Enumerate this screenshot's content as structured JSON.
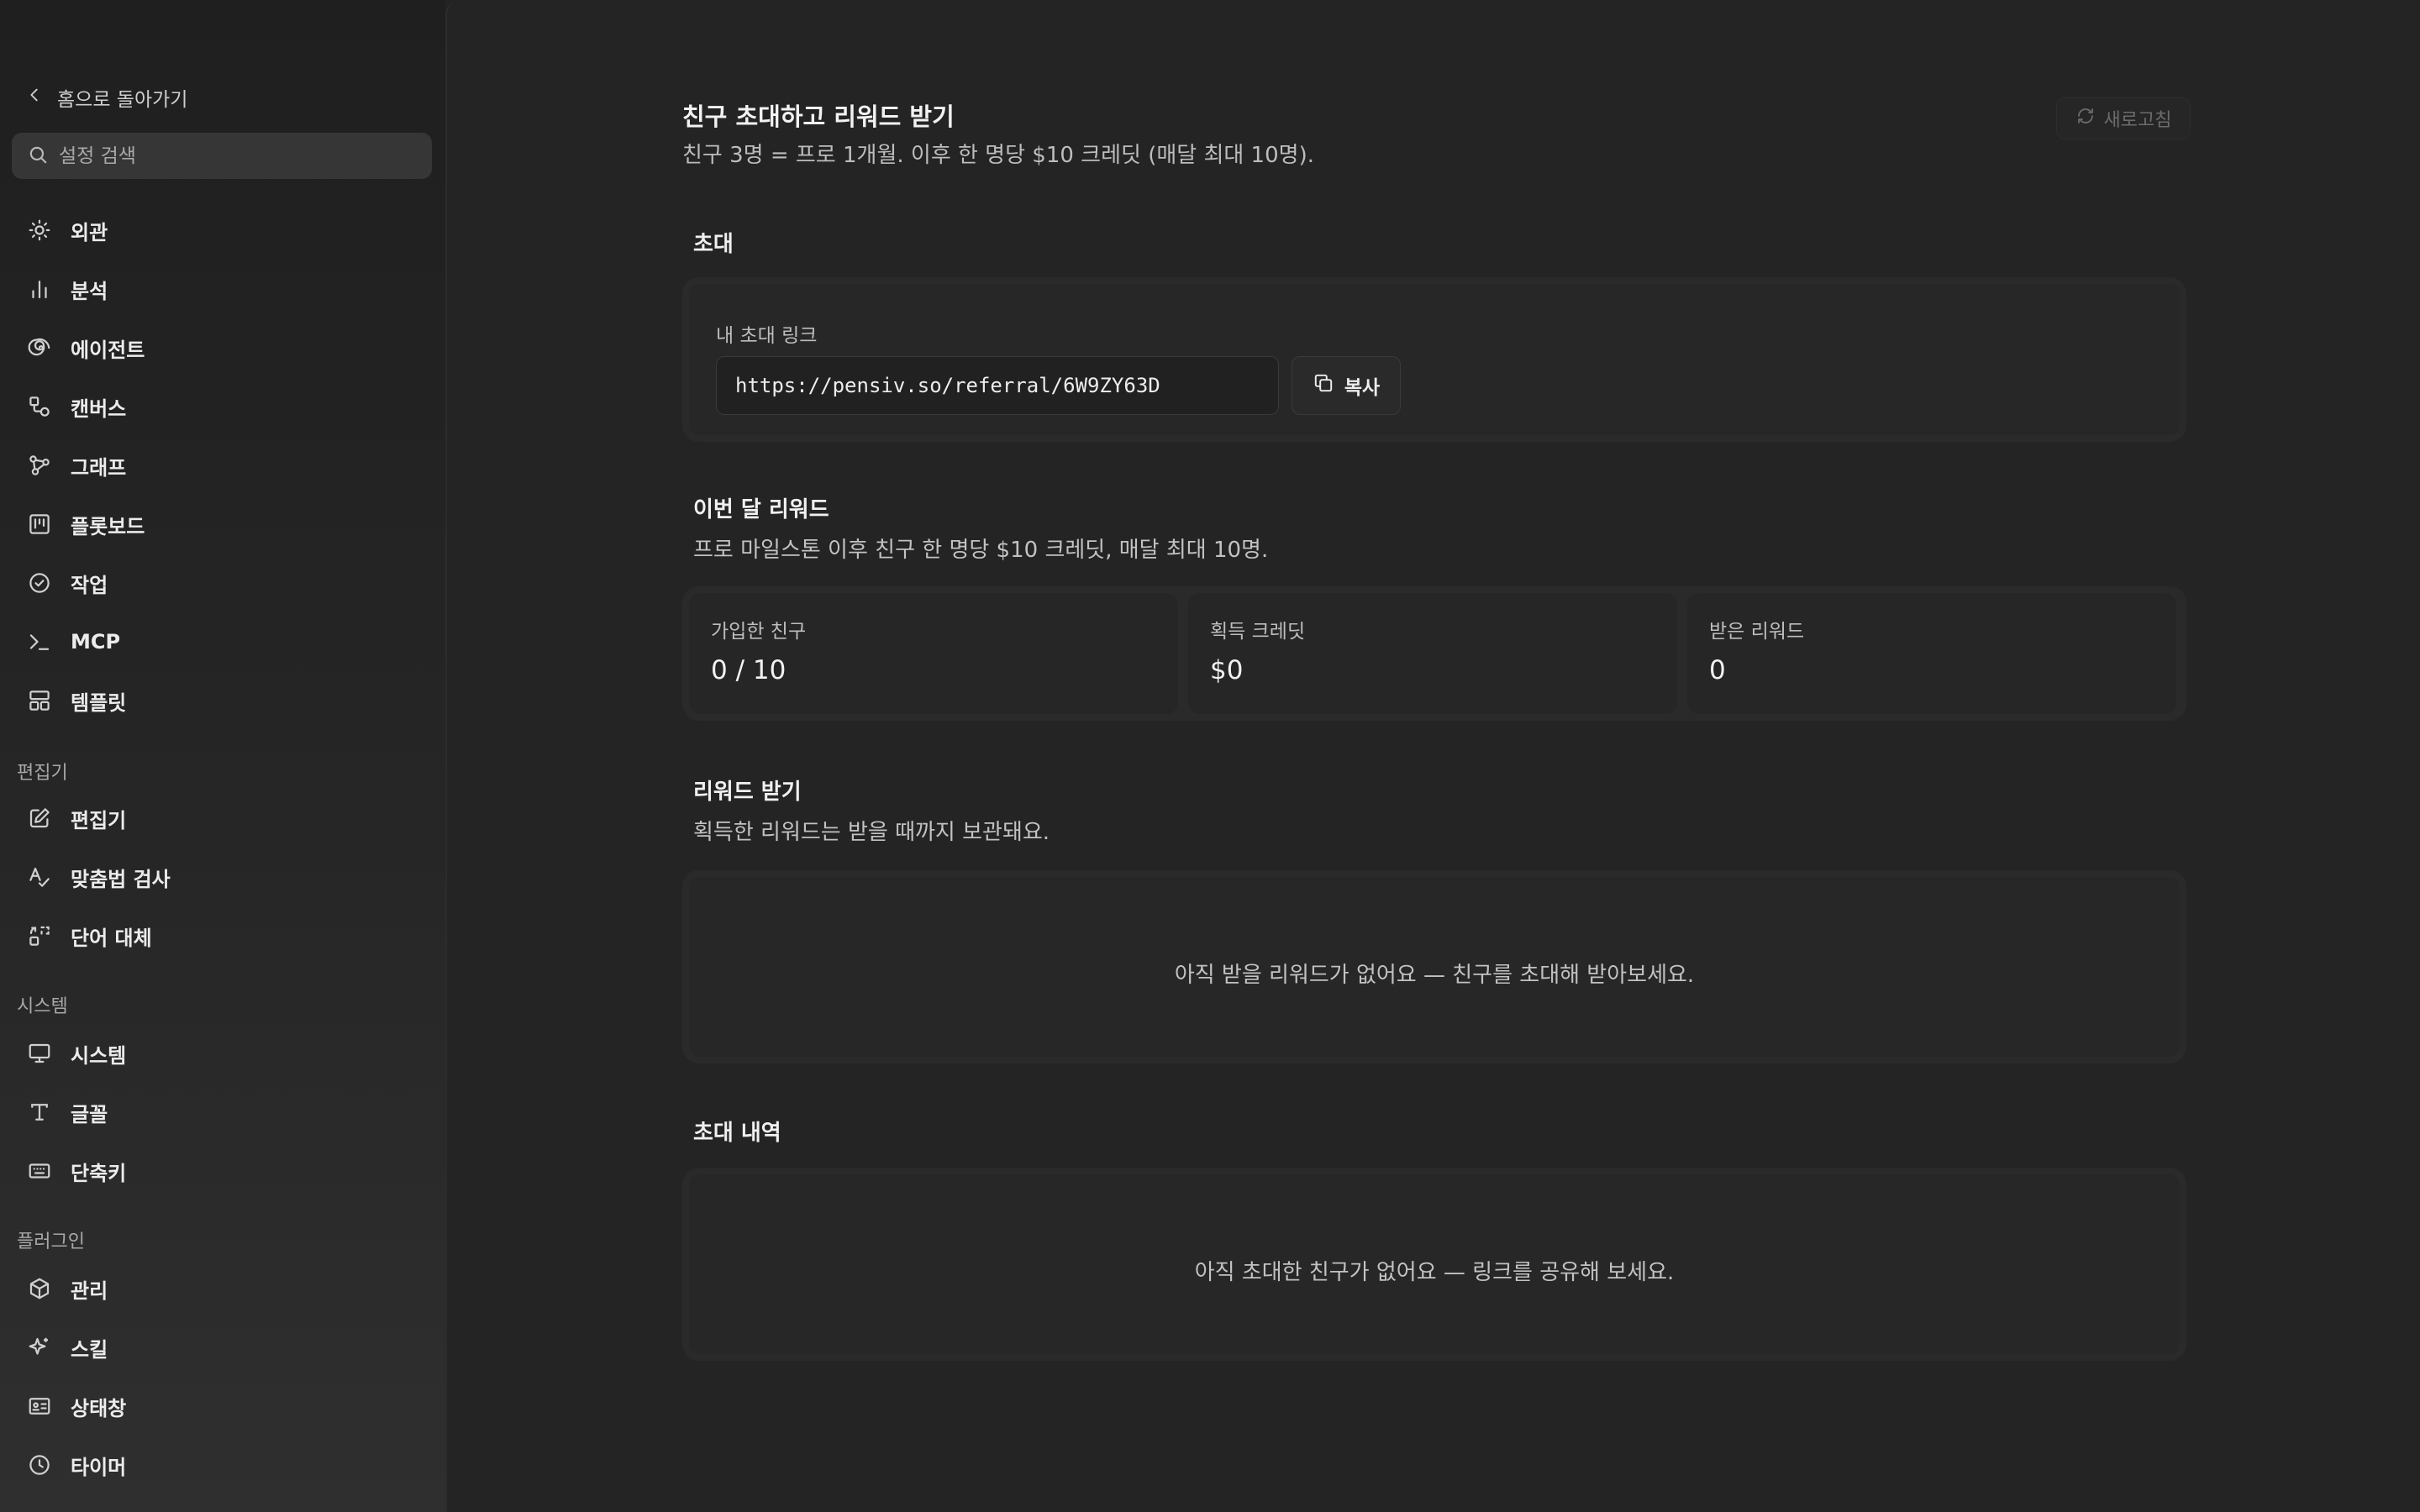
{
  "sidebar": {
    "back_label": "홈으로 돌아가기",
    "search_placeholder": "설정 검색",
    "items": [
      {
        "label": "외관",
        "icon": "sun-icon"
      },
      {
        "label": "분석",
        "icon": "bar-chart-icon"
      },
      {
        "label": "에이전트",
        "icon": "spiral-icon"
      },
      {
        "label": "캔버스",
        "icon": "shapes-icon"
      },
      {
        "label": "그래프",
        "icon": "graph-nodes-icon"
      },
      {
        "label": "플롯보드",
        "icon": "kanban-icon"
      },
      {
        "label": "작업",
        "icon": "check-circle-icon"
      },
      {
        "label": "MCP",
        "icon": "terminal-icon"
      },
      {
        "label": "템플릿",
        "icon": "layout-template-icon"
      }
    ],
    "sections": {
      "editor": {
        "label": "편집기",
        "items": [
          {
            "label": "편집기",
            "icon": "edit-icon"
          },
          {
            "label": "맞춤법 검사",
            "icon": "spell-check-icon"
          },
          {
            "label": "단어 대체",
            "icon": "replace-icon"
          }
        ]
      },
      "system": {
        "label": "시스템",
        "items": [
          {
            "label": "시스템",
            "icon": "monitor-icon"
          },
          {
            "label": "글꼴",
            "icon": "type-icon"
          },
          {
            "label": "단축키",
            "icon": "keyboard-icon"
          }
        ]
      },
      "plugins": {
        "label": "플러그인",
        "items": [
          {
            "label": "관리",
            "icon": "package-icon"
          },
          {
            "label": "스킬",
            "icon": "sparkles-icon"
          },
          {
            "label": "상태창",
            "icon": "id-card-icon"
          },
          {
            "label": "타이머",
            "icon": "clock-icon"
          }
        ]
      }
    }
  },
  "page": {
    "title": "친구 초대하고 리워드 받기",
    "subtitle": "친구 3명 = 프로 1개월. 이후 한 명당 $10 크레딧 (매달 최대 10명).",
    "refresh_label": "새로고침"
  },
  "invite": {
    "title": "초대",
    "link_label": "내 초대 링크",
    "link_value": "https://pensiv.so/referral/6W9ZY63D",
    "copy_label": "복사"
  },
  "monthly": {
    "title": "이번 달 리워드",
    "description": "프로 마일스톤 이후 친구 한 명당 $10 크레딧, 매달 최대 10명.",
    "stats": [
      {
        "label": "가입한 친구",
        "value": "0 / 10"
      },
      {
        "label": "획득 크레딧",
        "value": "$0"
      },
      {
        "label": "받은 리워드",
        "value": "0"
      }
    ]
  },
  "claim": {
    "title": "리워드 받기",
    "description": "획득한 리워드는 받을 때까지 보관돼요.",
    "empty": "아직 받을 리워드가 없어요 — 친구를 초대해 받아보세요."
  },
  "history": {
    "title": "초대 내역",
    "empty": "아직 초대한 친구가 없어요 — 링크를 공유해 보세요."
  }
}
